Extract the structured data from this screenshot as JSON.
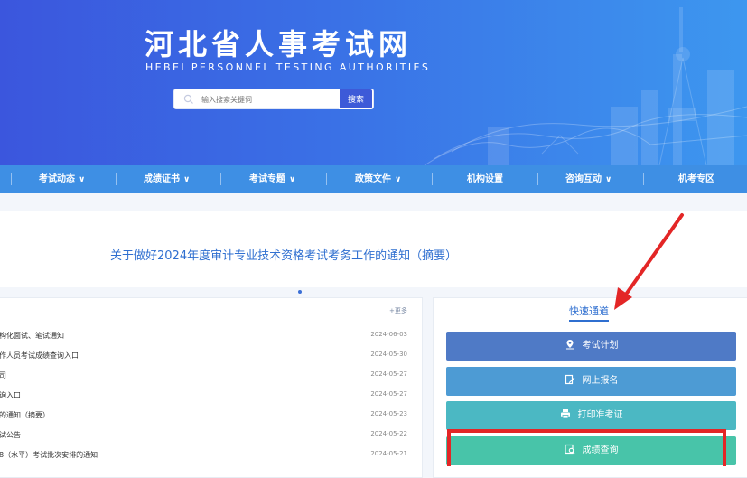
{
  "header": {
    "title": "河北省人事考试网",
    "subtitle": "HEBEI PERSONNEL TESTING AUTHORITIES",
    "search_placeholder": "输入搜索关键词",
    "search_button": "搜索"
  },
  "nav": {
    "items": [
      {
        "label": "考试动态",
        "caret": "∨"
      },
      {
        "label": "成绩证书",
        "caret": "∨"
      },
      {
        "label": "考试专题",
        "caret": "∨"
      },
      {
        "label": "政策文件",
        "caret": "∨"
      },
      {
        "label": "机构设置",
        "caret": ""
      },
      {
        "label": "咨询互动",
        "caret": "∨"
      },
      {
        "label": "机考专区",
        "caret": ""
      }
    ]
  },
  "notice": {
    "headline": "关于做好2024年度审计专业技术资格考试考务工作的通知（摘要）"
  },
  "news": {
    "more_label": "+更多",
    "rows": [
      {
        "title": "构化面试、笔试通知",
        "date": "2024-06-03"
      },
      {
        "title": "作人员考试成绩查询入口",
        "date": "2024-05-30"
      },
      {
        "title": "司",
        "date": "2024-05-27"
      },
      {
        "title": "询入口",
        "date": "2024-05-27"
      },
      {
        "title": "的通知（摘要）",
        "date": "2024-05-23"
      },
      {
        "title": "试公告",
        "date": "2024-05-22"
      },
      {
        "title": "8（水平）考试批次安排的通知",
        "date": "2024-05-21"
      }
    ]
  },
  "quick_access": {
    "title": "快速通道",
    "buttons": [
      {
        "label": "考试计划",
        "icon": "map-pin-icon",
        "color": "#4f7ac6"
      },
      {
        "label": "网上报名",
        "icon": "edit-form-icon",
        "color": "#4d9bd4"
      },
      {
        "label": "打印准考证",
        "icon": "printer-icon",
        "color": "#4bb8c3"
      },
      {
        "label": "成绩查询",
        "icon": "score-search-icon",
        "color": "#48c4a9"
      }
    ]
  },
  "colors": {
    "banner_start": "#3b56dd",
    "banner_end": "#3d97ef",
    "nav_bar": "#3e8fe4",
    "accent_text": "#2f6fd0",
    "annotation_red": "#e32626"
  }
}
